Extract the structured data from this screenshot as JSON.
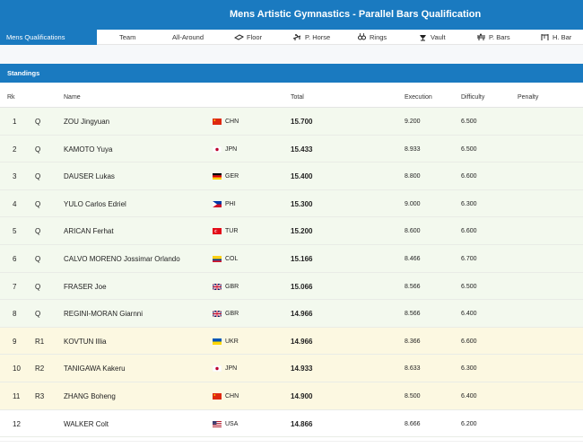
{
  "header": {
    "title": "Mens Artistic Gymnastics - Parallel Bars Qualification"
  },
  "tabs": [
    {
      "label": "Mens Qualifications",
      "icon": "",
      "active": true
    },
    {
      "label": "Team",
      "icon": ""
    },
    {
      "label": "All-Around",
      "icon": ""
    },
    {
      "label": "Floor",
      "icon": "floor-icon"
    },
    {
      "label": "P. Horse",
      "icon": "pommel-horse-icon"
    },
    {
      "label": "Rings",
      "icon": "rings-icon"
    },
    {
      "label": "Vault",
      "icon": "vault-icon"
    },
    {
      "label": "P. Bars",
      "icon": "parallel-bars-icon"
    },
    {
      "label": "H. Bar",
      "icon": "horizontal-bar-icon"
    }
  ],
  "section": {
    "title": "Standings"
  },
  "columns": {
    "rank": "Rk",
    "name": "Name",
    "total": "Total",
    "execution": "Execution",
    "difficulty": "Difficulty",
    "penalty": "Penalty"
  },
  "colors": {
    "accent": "#1a7ac0",
    "qualified_row": "#f3f9ee",
    "reserve_row": "#fcf8e1"
  },
  "rows": [
    {
      "rank": "1",
      "q": "Q",
      "name": "ZOU Jingyuan",
      "noc": "CHN",
      "total": "15.700",
      "execution": "9.200",
      "difficulty": "6.500",
      "penalty": "",
      "status": "q"
    },
    {
      "rank": "2",
      "q": "Q",
      "name": "KAMOTO Yuya",
      "noc": "JPN",
      "total": "15.433",
      "execution": "8.933",
      "difficulty": "6.500",
      "penalty": "",
      "status": "q"
    },
    {
      "rank": "3",
      "q": "Q",
      "name": "DAUSER Lukas",
      "noc": "GER",
      "total": "15.400",
      "execution": "8.800",
      "difficulty": "6.600",
      "penalty": "",
      "status": "q"
    },
    {
      "rank": "4",
      "q": "Q",
      "name": "YULO Carlos Edriel",
      "noc": "PHI",
      "total": "15.300",
      "execution": "9.000",
      "difficulty": "6.300",
      "penalty": "",
      "status": "q"
    },
    {
      "rank": "5",
      "q": "Q",
      "name": "ARICAN Ferhat",
      "noc": "TUR",
      "total": "15.200",
      "execution": "8.600",
      "difficulty": "6.600",
      "penalty": "",
      "status": "q"
    },
    {
      "rank": "6",
      "q": "Q",
      "name": "CALVO MORENO Jossimar Orlando",
      "noc": "COL",
      "total": "15.166",
      "execution": "8.466",
      "difficulty": "6.700",
      "penalty": "",
      "status": "q"
    },
    {
      "rank": "7",
      "q": "Q",
      "name": "FRASER Joe",
      "noc": "GBR",
      "total": "15.066",
      "execution": "8.566",
      "difficulty": "6.500",
      "penalty": "",
      "status": "q"
    },
    {
      "rank": "8",
      "q": "Q",
      "name": "REGINI-MORAN Giarnni",
      "noc": "GBR",
      "total": "14.966",
      "execution": "8.566",
      "difficulty": "6.400",
      "penalty": "",
      "status": "q"
    },
    {
      "rank": "9",
      "q": "R1",
      "name": "KOVTUN Illia",
      "noc": "UKR",
      "total": "14.966",
      "execution": "8.366",
      "difficulty": "6.600",
      "penalty": "",
      "status": "r"
    },
    {
      "rank": "10",
      "q": "R2",
      "name": "TANIGAWA Kakeru",
      "noc": "JPN",
      "total": "14.933",
      "execution": "8.633",
      "difficulty": "6.300",
      "penalty": "",
      "status": "r"
    },
    {
      "rank": "11",
      "q": "R3",
      "name": "ZHANG Boheng",
      "noc": "CHN",
      "total": "14.900",
      "execution": "8.500",
      "difficulty": "6.400",
      "penalty": "",
      "status": "r"
    },
    {
      "rank": "12",
      "q": "",
      "name": "WALKER Colt",
      "noc": "USA",
      "total": "14.866",
      "execution": "8.666",
      "difficulty": "6.200",
      "penalty": "",
      "status": "n"
    }
  ]
}
